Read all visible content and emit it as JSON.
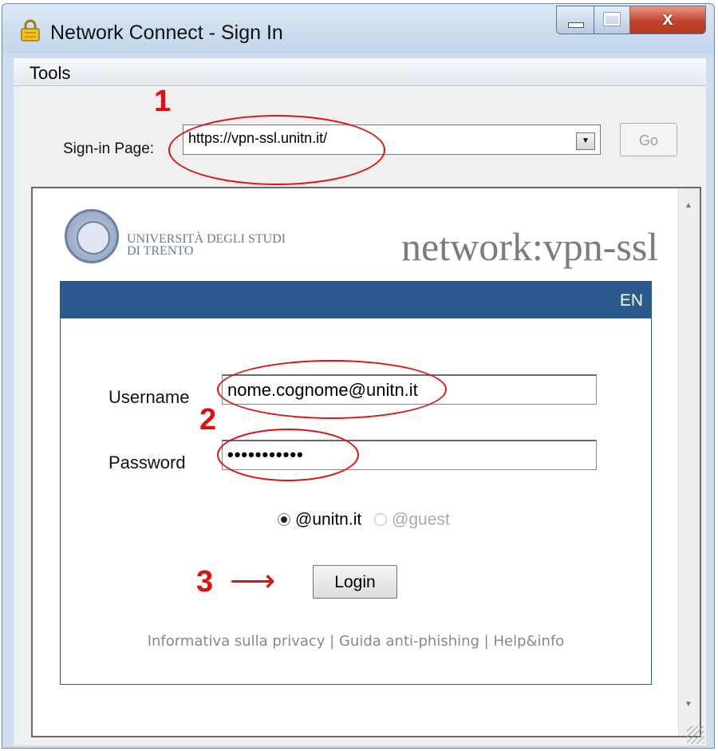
{
  "window": {
    "title": "Network Connect - Sign In",
    "close_glyph": "x"
  },
  "menu": {
    "tools": "Tools"
  },
  "signin": {
    "label": "Sign-in Page:",
    "url": "https://vpn-ssl.unitn.it/",
    "go_label": "Go"
  },
  "portal": {
    "university_line1": "UNIVERSITÀ DEGLI STUDI",
    "university_line2": "DI TRENTO",
    "site_title": "network:vpn-ssl",
    "language": "EN",
    "username_label": "Username",
    "username_value": "nome.cognome@unitn.it",
    "password_label": "Password",
    "password_value": "•••••••••••",
    "realm_options": [
      {
        "label": "@unitn.it",
        "selected": true
      },
      {
        "label": "@guest",
        "selected": false
      }
    ],
    "login_label": "Login",
    "footer": "Informativa sulla privacy | Guida anti-phishing | Help&info"
  },
  "annotations": {
    "step1": "1",
    "step2": "2",
    "step3": "3",
    "arrow": "⟶"
  },
  "colors": {
    "accent": "#2a5a8c",
    "annotation": "#e01010"
  },
  "icons": [
    "lock-icon",
    "minimize-icon",
    "maximize-icon",
    "close-icon",
    "dropdown-arrow-icon",
    "university-seal-icon",
    "scroll-up-icon",
    "scroll-down-icon",
    "resize-grip-icon"
  ]
}
